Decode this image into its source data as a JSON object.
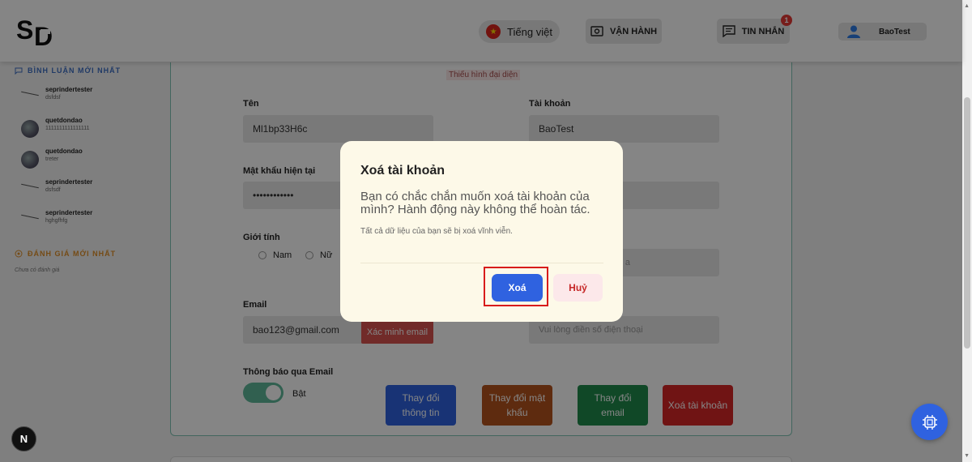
{
  "header": {
    "logo_text": "SD",
    "language_label": "Tiếng việt",
    "operations_label": "VẬN HÀNH",
    "messages_label": "TIN NHẮN",
    "messages_badge": "1",
    "user_name": "BaoTest"
  },
  "sidebar": {
    "comments_title": "BÌNH LUẬN MỚI NHẤT",
    "comments": [
      {
        "name": "seprindertester",
        "text": "dsfdsf"
      },
      {
        "name": "quetdondao",
        "text": "1111111111111111"
      },
      {
        "name": "quetdondao",
        "text": "treter"
      },
      {
        "name": "seprindertester",
        "text": "dsfsdf"
      },
      {
        "name": "seprindertester",
        "text": "hghgfhfg"
      }
    ],
    "reviews_title": "ĐÁNH GIÁ MỚI NHẤT",
    "reviews_empty": "Chưa có đánh giá"
  },
  "profile": {
    "avatar_missing": "Thiếu hình đại diện",
    "name_label": "Tên",
    "name_value": "Ml1bp33H6c",
    "account_label": "Tài khoản",
    "account_value": "BaoTest",
    "password_label": "Mật khẩu hiện tại",
    "password_value": "••••••••••••",
    "gender_label": "Giới tính",
    "gender_male": "Nam",
    "gender_female": "Nữ",
    "right_field_fragment": "a",
    "email_label": "Email",
    "email_value": "bao123@gmail.com",
    "verify_email": "Xác minh email",
    "phone_placeholder": "Vui lòng điền số điện thoại",
    "notify_label": "Thông báo qua Email",
    "notify_state": "Bật",
    "btn_update_info": "Thay đổi thông tin",
    "btn_change_password": "Thay đổi mật khẩu",
    "btn_change_email": "Thay đổi email",
    "btn_delete_account": "Xoá tài khoản"
  },
  "dialog": {
    "title": "Xoá tài khoản",
    "message": "Bạn có chắc chắn muốn xoá tài khoản của mình? Hành động này không thể hoàn tác.",
    "subtext": "Tất cả dữ liệu của bạn sẽ bị xoá vĩnh viễn.",
    "confirm": "Xoá",
    "cancel": "Huỷ"
  },
  "floating": {
    "next_label": "N"
  },
  "colors": {
    "primary": "#2f62e0",
    "danger": "#d62828",
    "highlight": "#d81b1b",
    "toggle_on": "#5fb89a"
  }
}
